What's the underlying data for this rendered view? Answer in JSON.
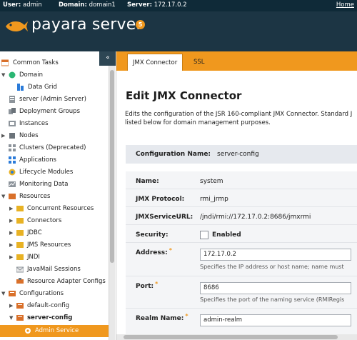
{
  "topbar": {
    "user_label": "User:",
    "user_value": "admin",
    "domain_label": "Domain:",
    "domain_value": "domain1",
    "server_label": "Server:",
    "server_value": "172.17.0.2",
    "home_link": "Home"
  },
  "brand": {
    "name": "payara server",
    "badge": "5",
    "accent": "#f0981e"
  },
  "sidebar": {
    "collapse_glyph": "«",
    "items": [
      {
        "label": "Common Tasks",
        "icon": "common-tasks-icon"
      },
      {
        "label": "Domain",
        "icon": "domain-icon"
      },
      {
        "label": "Data Grid",
        "icon": "data-grid-icon"
      },
      {
        "label": "server (Admin Server)",
        "icon": "server-icon"
      },
      {
        "label": "Deployment Groups",
        "icon": "deployment-groups-icon"
      },
      {
        "label": "Instances",
        "icon": "instances-icon"
      },
      {
        "label": "Nodes",
        "icon": "nodes-icon"
      },
      {
        "label": "Clusters (Deprecated)",
        "icon": "clusters-icon"
      },
      {
        "label": "Applications",
        "icon": "applications-icon"
      },
      {
        "label": "Lifecycle Modules",
        "icon": "lifecycle-icon"
      },
      {
        "label": "Monitoring Data",
        "icon": "monitoring-icon"
      },
      {
        "label": "Resources",
        "icon": "resources-icon"
      },
      {
        "label": "Concurrent Resources",
        "icon": "folder-icon"
      },
      {
        "label": "Connectors",
        "icon": "folder-icon"
      },
      {
        "label": "JDBC",
        "icon": "folder-icon"
      },
      {
        "label": "JMS Resources",
        "icon": "folder-icon"
      },
      {
        "label": "JNDI",
        "icon": "folder-icon"
      },
      {
        "label": "JavaMail Sessions",
        "icon": "mail-icon"
      },
      {
        "label": "Resource Adapter Configs",
        "icon": "adapter-icon"
      },
      {
        "label": "Configurations",
        "icon": "configurations-icon"
      },
      {
        "label": "default-config",
        "icon": "config-icon"
      },
      {
        "label": "server-config",
        "icon": "config-icon"
      },
      {
        "label": "Admin Service",
        "icon": "admin-service-icon"
      }
    ]
  },
  "tabs": [
    {
      "label": "JMX Connector",
      "active": true
    },
    {
      "label": "SSL",
      "active": false
    }
  ],
  "page": {
    "title": "Edit JMX Connector",
    "description": "Edits the configuration of the JSR 160-compliant JMX Connector. Standard J listed below for domain management purposes.",
    "config_name_label": "Configuration Name:",
    "config_name_value": "server-config"
  },
  "properties": {
    "name_label": "Name:",
    "name_value": "system",
    "protocol_label": "JMX Protocol:",
    "protocol_value": "rmi_jrmp",
    "url_label": "JMXServiceURL:",
    "url_value": "/jndi/rmi://172.17.0.2:8686/jmxrmi",
    "security_label": "Security:",
    "security_checkbox_label": "Enabled",
    "address_label": "Address:",
    "address_value": "172.17.0.2",
    "address_help": "Specifies the IP address or host name; name must",
    "port_label": "Port:",
    "port_value": "8686",
    "port_help": "Specifies the port of the naming service (RMIRegis",
    "realm_label": "Realm Name:",
    "realm_value": "admin-realm",
    "required_marker": "*"
  }
}
